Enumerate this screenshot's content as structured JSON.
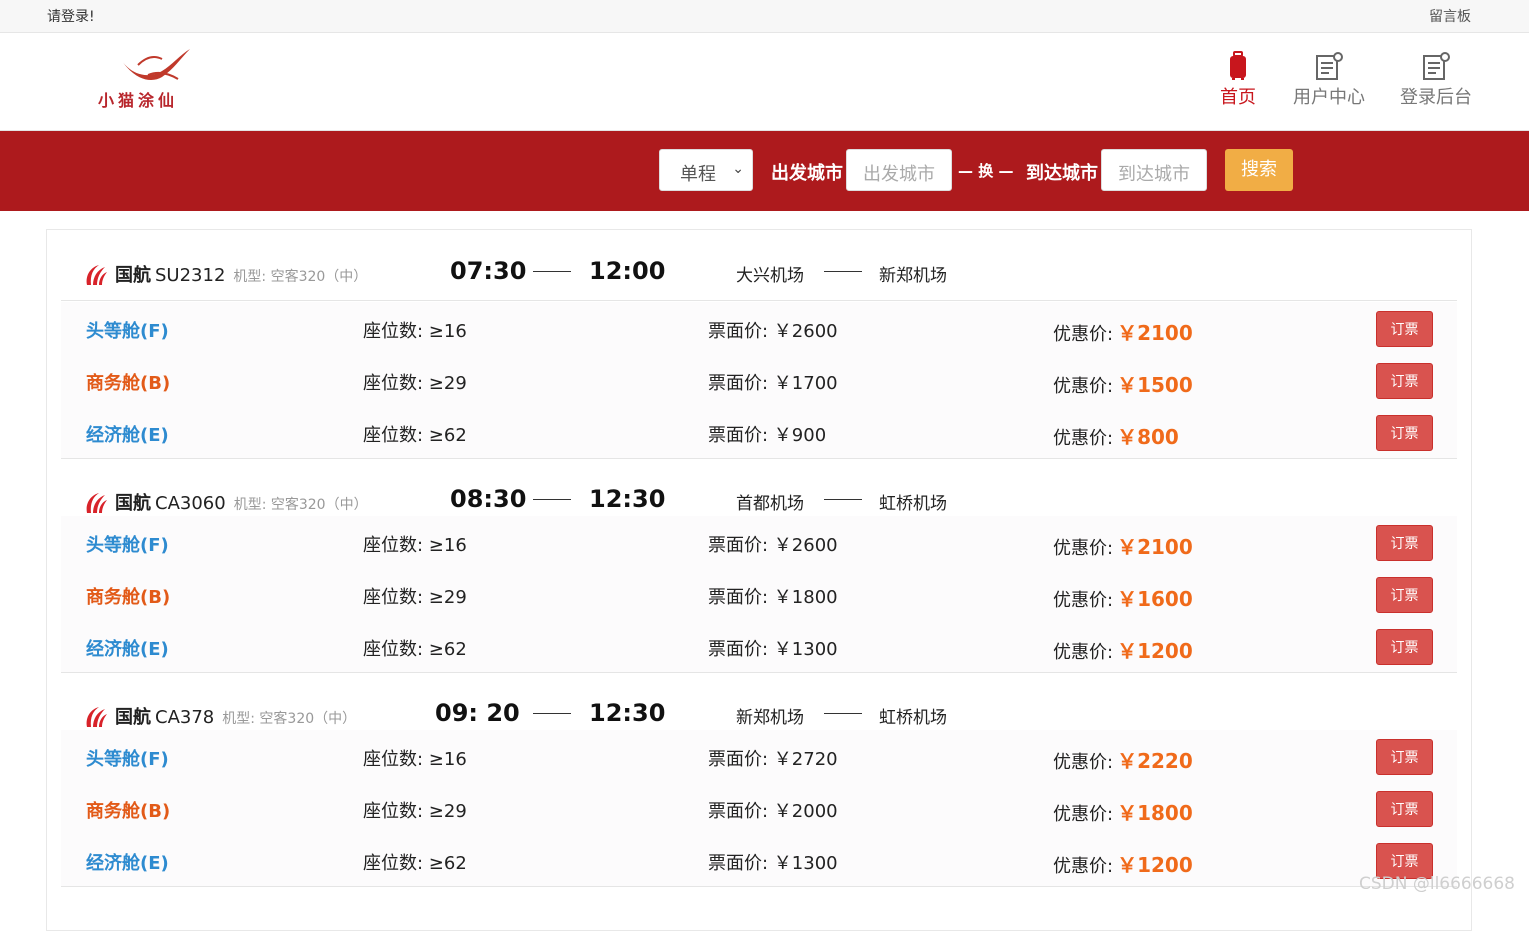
{
  "topbar": {
    "login": "请登录!",
    "board": "留言板"
  },
  "logo": {
    "text": "小猫涂仙"
  },
  "nav": [
    {
      "label": "首页",
      "icon": "luggage-icon"
    },
    {
      "label": "用户中心",
      "icon": "settings-doc-icon"
    },
    {
      "label": "登录后台",
      "icon": "settings-doc-icon"
    }
  ],
  "search": {
    "trip_type": "单程",
    "from_label": "出发城市",
    "from_placeholder": "出发城市",
    "swap": "— 换 —",
    "to_label": "到达城市",
    "to_placeholder": "到达城市",
    "button": "搜索"
  },
  "flights": [
    {
      "airline": "国航",
      "number": "SU2312",
      "model": "机型: 空客320（中）",
      "dep": "07:30",
      "arr": "12:00",
      "from": "大兴机场",
      "to": "新郑机场",
      "classes": [
        {
          "name": "头等舱(F)",
          "seats": "座位数: ≥16",
          "price": "票面价: ￥2600",
          "disc_label": "优惠价:",
          "disc": "￥2100",
          "book": "订票"
        },
        {
          "name": "商务舱(B)",
          "seats": "座位数: ≥29",
          "price": "票面价: ￥1700",
          "disc_label": "优惠价:",
          "disc": "￥1500",
          "book": "订票"
        },
        {
          "name": "经济舱(E)",
          "seats": "座位数: ≥62",
          "price": "票面价: ￥900",
          "disc_label": "优惠价:",
          "disc": "￥800",
          "book": "订票"
        }
      ]
    },
    {
      "airline": "国航",
      "number": "CA3060",
      "model": "机型: 空客320（中）",
      "dep": "08:30",
      "arr": "12:30",
      "from": "首都机场",
      "to": "虹桥机场",
      "classes": [
        {
          "name": "头等舱(F)",
          "seats": "座位数: ≥16",
          "price": "票面价: ￥2600",
          "disc_label": "优惠价:",
          "disc": "￥2100",
          "book": "订票"
        },
        {
          "name": "商务舱(B)",
          "seats": "座位数: ≥29",
          "price": "票面价: ￥1800",
          "disc_label": "优惠价:",
          "disc": "￥1600",
          "book": "订票"
        },
        {
          "name": "经济舱(E)",
          "seats": "座位数: ≥62",
          "price": "票面价: ￥1300",
          "disc_label": "优惠价:",
          "disc": "￥1200",
          "book": "订票"
        }
      ]
    },
    {
      "airline": "国航",
      "number": "CA378",
      "model": "机型: 空客320（中）",
      "dep": "09: 20",
      "arr": "12:30",
      "from": "新郑机场",
      "to": "虹桥机场",
      "classes": [
        {
          "name": "头等舱(F)",
          "seats": "座位数: ≥16",
          "price": "票面价: ￥2720",
          "disc_label": "优惠价:",
          "disc": "￥2220",
          "book": "订票"
        },
        {
          "name": "商务舱(B)",
          "seats": "座位数: ≥29",
          "price": "票面价: ￥2000",
          "disc_label": "优惠价:",
          "disc": "￥1800",
          "book": "订票"
        },
        {
          "name": "经济舱(E)",
          "seats": "座位数: ≥62",
          "price": "票面价: ￥1300",
          "disc_label": "优惠价:",
          "disc": "￥1200",
          "book": "订票"
        }
      ]
    }
  ],
  "watermark": "CSDN @ll6666668",
  "colors": {
    "brand_red": "#ad1a1d",
    "search_button": "#f1ad45",
    "book_button": "#d9534f",
    "discount": "#f06a1a",
    "class_blue": "#2e8bd0",
    "class_orange": "#e25a18"
  }
}
